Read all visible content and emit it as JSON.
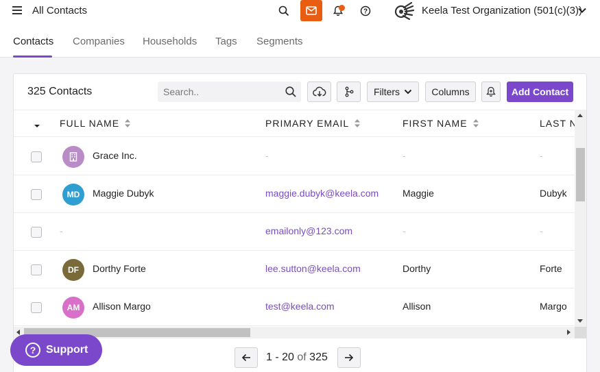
{
  "topbar": {
    "title": "All Contacts",
    "organization": "Keela Test Organization (501(c)(3))",
    "help_glyph": "?",
    "icons": [
      "menu-icon",
      "search-icon",
      "mail-icon",
      "bell-icon",
      "help-icon",
      "chevron-down-icon"
    ],
    "colors": {
      "mail_button": "#e95d12",
      "notification_dot": "#e95d12"
    }
  },
  "tabs": [
    {
      "label": "Contacts",
      "active": true
    },
    {
      "label": "Companies",
      "active": false
    },
    {
      "label": "Households",
      "active": false
    },
    {
      "label": "Tags",
      "active": false
    },
    {
      "label": "Segments",
      "active": false
    }
  ],
  "card": {
    "title": "325 Contacts",
    "search_placeholder": "Search..",
    "filters_label": "Filters",
    "columns_label": "Columns",
    "add_label": "Add Contact",
    "accent": "#7b48cc"
  },
  "table": {
    "columns": [
      "FULL NAME",
      "PRIMARY EMAIL",
      "FIRST NAME",
      "LAST N"
    ],
    "rows": [
      {
        "initials": "",
        "avatar_color": "#b98bc7",
        "avatar_type": "building-icon",
        "full_name": "Grace Inc.",
        "email": "-",
        "first_name": "-",
        "last_name": "-"
      },
      {
        "initials": "MD",
        "avatar_color": "#2f9fd1",
        "full_name": "Maggie Dubyk",
        "email": "maggie.dubyk@keela.com",
        "first_name": "Maggie",
        "last_name": "Dubyk"
      },
      {
        "initials": "",
        "avatar_color": "",
        "full_name": "-",
        "email": "emailonly@123.com",
        "first_name": "-",
        "last_name": "-"
      },
      {
        "initials": "DF",
        "avatar_color": "#7a6a3a",
        "full_name": "Dorthy Forte",
        "email": "lee.sutton@keela.com",
        "first_name": "Dorthy",
        "last_name": "Forte"
      },
      {
        "initials": "AM",
        "avatar_color": "#d86fc9",
        "full_name": "Allison Margo",
        "email": "test@keela.com",
        "first_name": "Allison",
        "last_name": "Margo"
      }
    ]
  },
  "pagination": {
    "range": "1 - 20",
    "of": "of",
    "total": "325"
  },
  "support": {
    "label": "Support",
    "glyph": "?"
  }
}
